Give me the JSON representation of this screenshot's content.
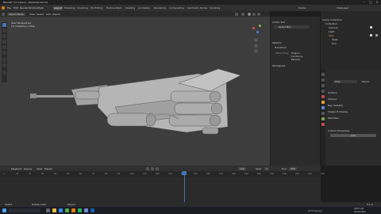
{
  "window": {
    "title": "Blender* [C:\\Users\\...\\bestship.blend]"
  },
  "menus": [
    "File",
    "Edit",
    "Render",
    "Window",
    "Help"
  ],
  "workspaces": [
    "Layout",
    "Modeling",
    "Sculpting",
    "UV Editing",
    "Texture Paint",
    "Shading",
    "Animation",
    "Rendering",
    "Compositing",
    "Geometry Nodes",
    "Scripting"
  ],
  "active_workspace": "Layout",
  "viewport": {
    "mode": "Object Mode",
    "menus": [
      "View",
      "Select",
      "Add",
      "Object"
    ],
    "overlay_line1": "User Perspective",
    "overlay_line2": "(1) Collection | Ship"
  },
  "scene": {
    "scene_label": "Scene",
    "layer_label": "ViewLayer"
  },
  "tool_panel": {
    "header": "Active Tool",
    "tool_name": "Select Box",
    "options": "Options",
    "transform": "Transform",
    "affect_only": "Affect Only",
    "origins": "Origins",
    "locations": "Locations",
    "parents": "Parents",
    "workspace": "Workspace"
  },
  "outliner": {
    "items": [
      "Scene Collection",
      "Collection",
      "Camera",
      "Light",
      "Ship",
      "Shell",
      "Hull"
    ]
  },
  "properties": {
    "object_name": "Ship",
    "world": "World",
    "sections": [
      "Surface",
      "Volume",
      "Ray Visibility",
      "Viewport Display",
      "Mist Pass",
      "Custom Properties"
    ],
    "add_label": "Add"
  },
  "timeline": {
    "menus": [
      "Playback",
      "Keying",
      "View",
      "Marker"
    ],
    "ticks": [
      "0",
      "10",
      "20",
      "30",
      "40",
      "50",
      "60",
      "70",
      "80",
      "90",
      "100",
      "110",
      "120",
      "130",
      "140",
      "150",
      "160",
      "170",
      "180",
      "190",
      "200",
      "210",
      "220",
      "230",
      "240",
      "250"
    ],
    "current_frame": "130",
    "start_label": "Start",
    "start": "1",
    "end_label": "End",
    "end": "250"
  },
  "status": {
    "left": "Select",
    "middle": "Rotate View",
    "right": "Object",
    "version": "3.1.2"
  },
  "taskbar": {
    "weather": "27°C Sunny",
    "time": "09:57 AM",
    "date": "03-01-2022"
  },
  "colors": {
    "accent": "#4772b3",
    "active_orange": "#e8a13a"
  }
}
